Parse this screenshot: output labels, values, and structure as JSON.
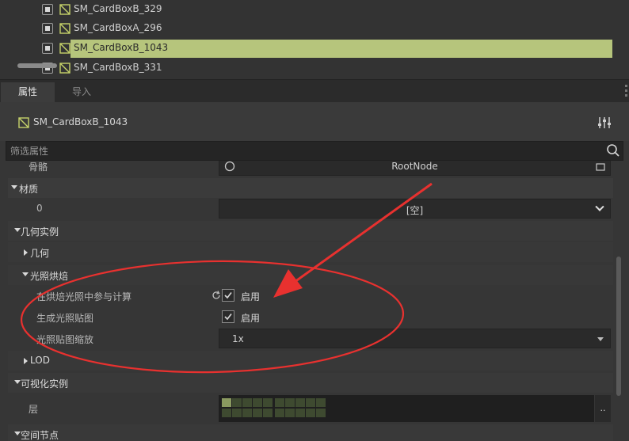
{
  "tree": {
    "items": [
      {
        "name": "SM_CardBoxB_329",
        "selected": false
      },
      {
        "name": "SM_CardBoxA_296",
        "selected": false
      },
      {
        "name": "SM_CardBoxB_1043",
        "selected": true
      },
      {
        "name": "SM_CardBoxB_331",
        "selected": false
      }
    ],
    "selected_color": "#b6c57c"
  },
  "tabs": {
    "properties": "属性",
    "import": "导入"
  },
  "header": {
    "title": "SM_CardBoxB_1043",
    "icon": "mesh-icon",
    "settings_icon": "sliders-icon"
  },
  "filter": {
    "placeholder": "筛选属性",
    "icon": "search-icon"
  },
  "properties": {
    "skeleton_label": "骨骼",
    "skeleton_value": "RootNode",
    "material_section": "材质",
    "material_index": "0",
    "material_value": "[空]",
    "geometry_instance_section": "几何实例",
    "geometry_section": "几何",
    "lightmap_section": "光照烘焙",
    "bake_participate_label": "在烘焙光照中参与计算",
    "bake_participate_value": "启用",
    "generate_lightmap_label": "生成光照贴图",
    "generate_lightmap_value": "启用",
    "lightmap_scale_label": "光照贴图缩放",
    "lightmap_scale_value": "1x",
    "lod_section": "LOD",
    "visual_instance_section": "可视化实例",
    "layers_label": "层",
    "layers_button": "..",
    "spatial_section": "空间节点"
  },
  "colors": {
    "annotation": "#e8312f",
    "accent": "#b6c57c"
  }
}
